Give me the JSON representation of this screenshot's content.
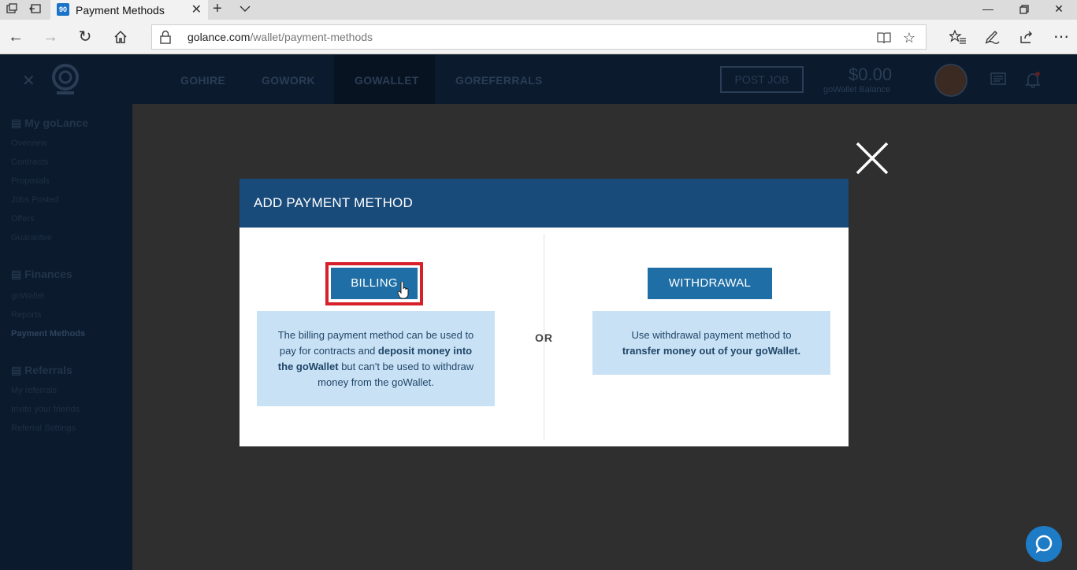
{
  "browser": {
    "tab_title": "Payment Methods",
    "tab_favicon_text": "90",
    "url_host": "golance.com",
    "url_path": "/wallet/payment-methods"
  },
  "site": {
    "nav": [
      "GOHIRE",
      "GOWORK",
      "GOWALLET",
      "GOREFERRALS"
    ],
    "post_job": "POST JOB",
    "balance": "$0.00",
    "balance_label": "goWallet Balance",
    "sidebar": {
      "section_my": "My goLance",
      "my_items": [
        "Overview",
        "Contracts",
        "Proposals",
        "Jobs Posted",
        "Offers",
        "Guarantee"
      ],
      "section_finances": "Finances",
      "finance_items": [
        "goWallet",
        "Reports",
        "Payment Methods"
      ],
      "section_referrals": "Referrals",
      "referral_items": [
        "My referrals",
        "Invite your friends",
        "Referral Settings"
      ]
    }
  },
  "modal": {
    "title": "ADD PAYMENT METHOD",
    "or_label": "OR",
    "billing": {
      "button": "BILLING",
      "text_1": "The billing payment method can be used to pay for contracts and ",
      "text_bold_1": "deposit money into the goWallet",
      "text_2": " but can't be used to withdraw money from the goWallet."
    },
    "withdrawal": {
      "button": "WITHDRAWAL",
      "text_1": "Use withdrawal payment method to ",
      "text_bold_1": "transfer money out of your goWallet."
    }
  },
  "colors": {
    "modal_header": "#184a7a",
    "button": "#1f6fa6",
    "info_bg": "#c9e1f5",
    "highlight": "#d6202a",
    "chat": "#1e7bc6"
  }
}
